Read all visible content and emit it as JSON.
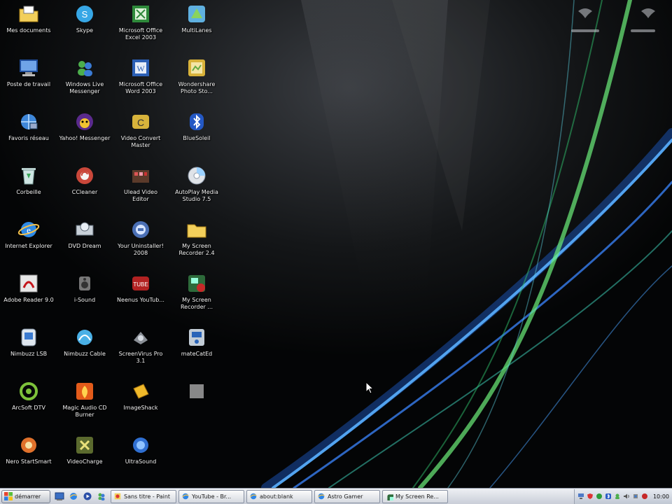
{
  "colors": {
    "desktop_bg": "#050607",
    "taskbar": "#d9dde5",
    "ribbon_green": "#6cf07a",
    "ribbon_blue": "#4aa3ff"
  },
  "desktop": {
    "icons": [
      {
        "label": "Mes documents",
        "icon": "folder-docs-icon"
      },
      {
        "label": "Skype",
        "icon": "skype-icon"
      },
      {
        "label": "Microsoft Office Excel 2003",
        "icon": "excel-icon"
      },
      {
        "label": "MultiLanes",
        "icon": "app-icon"
      },
      {
        "label": "Poste de travail",
        "icon": "computer-icon"
      },
      {
        "label": "Windows Live Messenger",
        "icon": "messenger-icon"
      },
      {
        "label": "Microsoft Office Word 2003",
        "icon": "word-icon"
      },
      {
        "label": "Wondershare Photo Sto...",
        "icon": "photo-icon"
      },
      {
        "label": "Favoris réseau",
        "icon": "network-icon"
      },
      {
        "label": "Yahoo! Messenger",
        "icon": "yahoo-icon"
      },
      {
        "label": "Video Convert Master",
        "icon": "video-convert-icon"
      },
      {
        "label": "BlueSoleil",
        "icon": "bluetooth-icon"
      },
      {
        "label": "Corbeille",
        "icon": "recycle-bin-icon"
      },
      {
        "label": "CCleaner",
        "icon": "ccleaner-icon"
      },
      {
        "label": "Ulead Video Editor",
        "icon": "film-icon"
      },
      {
        "label": "AutoPlay Media Studio 7.5",
        "icon": "cd-icon"
      },
      {
        "label": "Internet Explorer",
        "icon": "ie-icon"
      },
      {
        "label": "DVD Dream",
        "icon": "dvd-icon"
      },
      {
        "label": "Your Uninstaller! 2008",
        "icon": "uninstaller-icon"
      },
      {
        "label": "My Screen Recorder 2.4",
        "icon": "folder-icon"
      },
      {
        "label": "Adobe Reader 9.0",
        "icon": "adobe-icon"
      },
      {
        "label": "i-Sound",
        "icon": "sound-icon"
      },
      {
        "label": "Neenus YouTub...",
        "icon": "youtube-icon"
      },
      {
        "label": "My Screen Recorder ...",
        "icon": "recorder-icon"
      },
      {
        "label": "Nimbuzz LSB",
        "icon": "nimbuzz-icon"
      },
      {
        "label": "Nimbuzz Cable",
        "icon": "cable-icon"
      },
      {
        "label": "ScreenVirus Pro 3.1",
        "icon": "screen-icon"
      },
      {
        "label": "mateCatEd",
        "icon": "mate-icon"
      },
      {
        "label": "ArcSoft DTV",
        "icon": "arcsoft-icon"
      },
      {
        "label": "Magic Audio CD Burner",
        "icon": "burner-icon"
      },
      {
        "label": "ImageShack",
        "icon": "imageshack-icon"
      },
      {
        "label": "",
        "icon": "blank-icon"
      },
      {
        "label": "Nero StartSmart",
        "icon": "nero-icon"
      },
      {
        "label": "VideoCharge",
        "icon": "videocharge-icon"
      },
      {
        "label": "UltraSound",
        "icon": "ultrasound-icon"
      }
    ]
  },
  "taskbar": {
    "start_label": "démarrer",
    "tasks": [
      {
        "label": "Sans titre - Paint",
        "icon": "paint-icon"
      },
      {
        "label": "YouTube - Br...",
        "icon": "browser-icon"
      },
      {
        "label": "about:blank",
        "icon": "browser-icon"
      },
      {
        "label": "Astro Gamer",
        "icon": "browser-icon"
      },
      {
        "label": "My Screen Re...",
        "icon": "recorder-icon"
      }
    ],
    "clock": "10:00"
  }
}
